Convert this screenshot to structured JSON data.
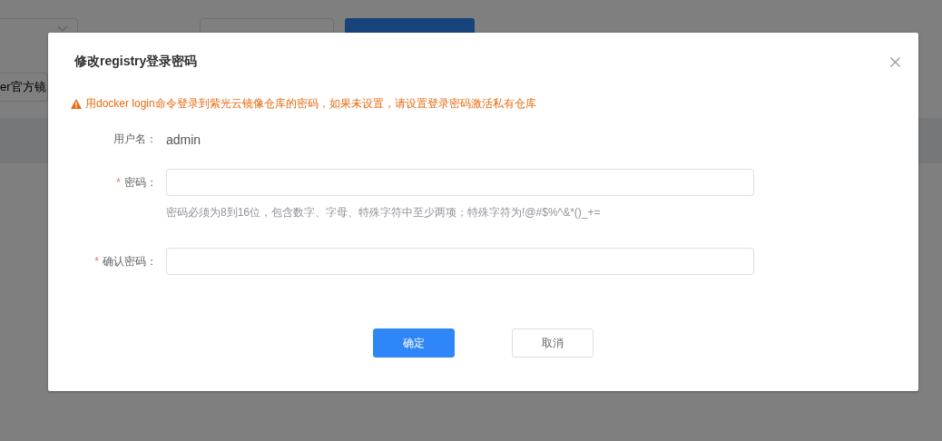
{
  "background": {
    "mirror_button": "er官方镜"
  },
  "dialog": {
    "title": "修改registry登录密码",
    "warning": "用docker login命令登录到紫光云镜像仓库的密码，如果未设置，请设置登录密码激活私有仓库",
    "fields": [
      {
        "kind": "static",
        "label": "用户名：",
        "value": "admin"
      },
      {
        "kind": "password",
        "required_mark": "*",
        "label": "密码：",
        "hint": "密码必须为8到16位，包含数字、字母、特殊字符中至少两项；特殊字符为!@#$%^&*()_+="
      },
      {
        "kind": "password",
        "required_mark": "*",
        "label": "确认密码："
      }
    ],
    "buttons": [
      {
        "label": "确定",
        "kind": "primary"
      },
      {
        "label": "取消",
        "kind": "default"
      }
    ]
  }
}
